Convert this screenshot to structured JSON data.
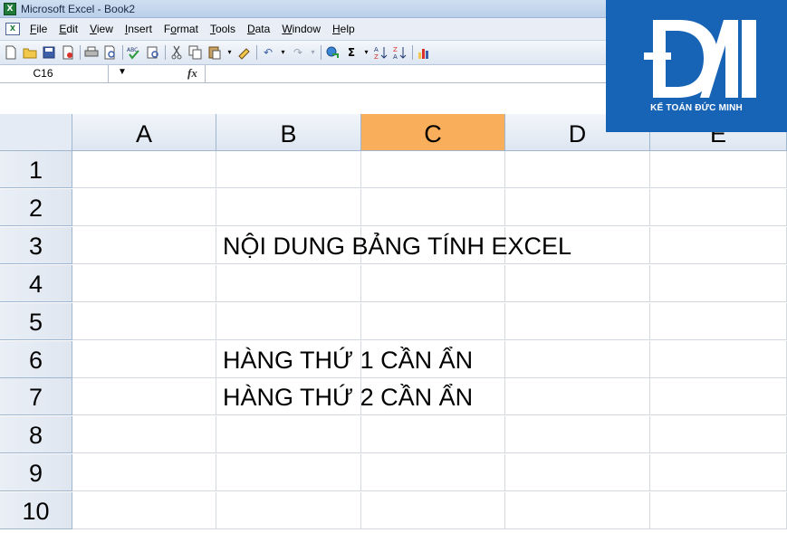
{
  "window": {
    "title": "Microsoft Excel - Book2"
  },
  "menu": {
    "items": [
      {
        "label": "File",
        "accel": "F"
      },
      {
        "label": "Edit",
        "accel": "E"
      },
      {
        "label": "View",
        "accel": "V"
      },
      {
        "label": "Insert",
        "accel": "I"
      },
      {
        "label": "Format",
        "accel": "o"
      },
      {
        "label": "Tools",
        "accel": "T"
      },
      {
        "label": "Data",
        "accel": "D"
      },
      {
        "label": "Window",
        "accel": "W"
      },
      {
        "label": "Help",
        "accel": "H"
      }
    ]
  },
  "toolbar": {
    "icons": [
      "new-icon",
      "open-icon",
      "save-icon",
      "permission-icon",
      "print-icon",
      "print-preview-icon",
      "spelling-icon",
      "research-icon",
      "cut-icon",
      "copy-icon",
      "paste-icon",
      "format-painter-icon",
      "undo-icon",
      "redo-icon",
      "hyperlink-icon",
      "autosum-icon",
      "sort-ascending-icon",
      "sort-descending-icon",
      "chart-wizard-icon"
    ]
  },
  "formula_bar": {
    "name_box": "C16",
    "fx": "fx",
    "formula": ""
  },
  "columns": [
    "A",
    "B",
    "C",
    "D",
    "E"
  ],
  "active_column": "C",
  "rows": [
    {
      "num": "1",
      "text": ""
    },
    {
      "num": "2",
      "text": ""
    },
    {
      "num": "3",
      "text": "NỘI DUNG BẢNG TÍNH EXCEL"
    },
    {
      "num": "4",
      "text": ""
    },
    {
      "num": "5",
      "text": ""
    },
    {
      "num": "6",
      "text": "HÀNG THỨ 1 CẦN ẨN"
    },
    {
      "num": "7",
      "text": "HÀNG THỨ 2 CẦN ẨN"
    },
    {
      "num": "8",
      "text": ""
    },
    {
      "num": "9",
      "text": ""
    },
    {
      "num": "10",
      "text": ""
    }
  ],
  "logo": {
    "text": "KẾ TOÁN ĐỨC MINH",
    "color": "#1763b6"
  },
  "colors": {
    "selected_header": "#f8ae5a",
    "header_bg": "#dde6f1"
  }
}
